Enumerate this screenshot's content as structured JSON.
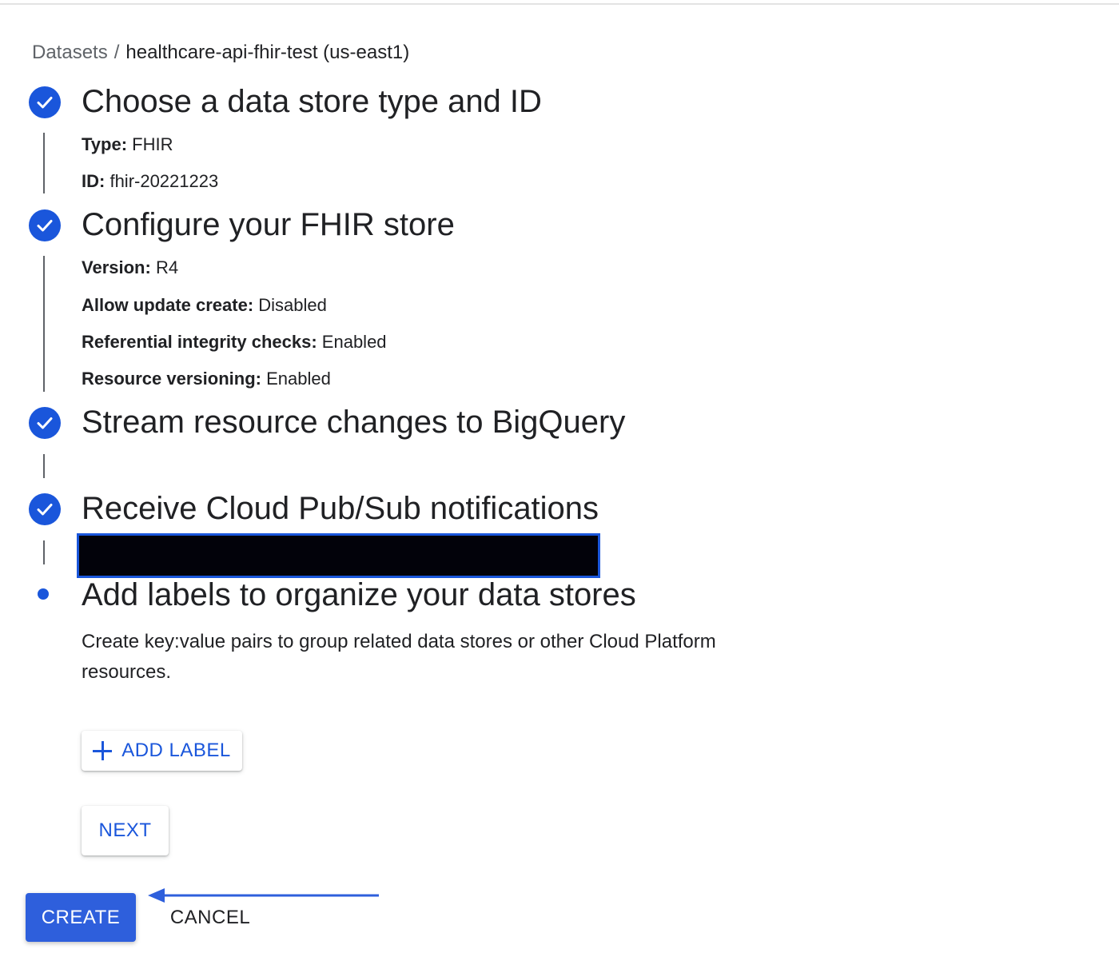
{
  "breadcrumb": {
    "parent": "Datasets",
    "separator": "/",
    "current": "healthcare-api-fhir-test (us-east1)"
  },
  "steps": [
    {
      "title": "Choose a data store type and ID",
      "status": "complete",
      "details": [
        {
          "label": "Type:",
          "value": "FHIR"
        },
        {
          "label": "ID:",
          "value": "fhir-20221223"
        }
      ]
    },
    {
      "title": "Configure your FHIR store",
      "status": "complete",
      "details": [
        {
          "label": "Version:",
          "value": "R4"
        },
        {
          "label": "Allow update create:",
          "value": "Disabled"
        },
        {
          "label": "Referential integrity checks:",
          "value": "Enabled"
        },
        {
          "label": "Resource versioning:",
          "value": "Enabled"
        }
      ]
    },
    {
      "title": "Stream resource changes to BigQuery",
      "status": "complete",
      "details": []
    },
    {
      "title": "Receive Cloud Pub/Sub notifications",
      "status": "complete",
      "details": []
    },
    {
      "title": "Add labels to organize your data stores",
      "status": "active",
      "description": "Create key:value pairs to group related data stores or other Cloud Platform resources."
    }
  ],
  "buttons": {
    "add_label": "ADD LABEL",
    "next": "NEXT",
    "create": "CREATE",
    "cancel": "CANCEL"
  },
  "icons": {
    "step_complete": "check-circle-icon",
    "step_active": "dot-icon",
    "add": "plus-icon",
    "annotation": "arrow-left-icon"
  },
  "colors": {
    "accent": "#1a56db",
    "primary_button": "#2e5fdc",
    "text": "#202124",
    "muted": "#5f6368"
  }
}
